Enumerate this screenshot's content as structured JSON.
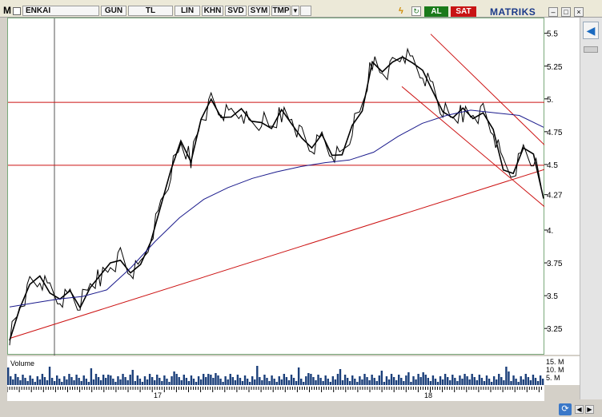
{
  "toolbar": {
    "m_label": "M",
    "symbol": "ENKAI",
    "buttons": [
      "GUN",
      "TL",
      "LIN",
      "KHN",
      "SVD",
      "SYM",
      "TMP"
    ],
    "buy_label": "AL",
    "sell_label": "SAT",
    "logo": "MATRIKS"
  },
  "colors": {
    "price": "#000000",
    "ma": "#1a1a8c",
    "trend": "#cc1111",
    "volume": "#1b3f7a",
    "grid": "#7aa87a"
  },
  "chart_data": {
    "type": "line",
    "symbol": "ENKAI",
    "ylim": [
      3.05,
      5.62
    ],
    "y_ticks": [
      "5.5",
      "5.25",
      "5.",
      "4.75",
      "4.5",
      "4.27",
      "4.",
      "3.75",
      "3.5",
      "3.25"
    ],
    "x_labels": [
      "17",
      "18"
    ],
    "last_price": "4.27",
    "price_series": [
      3.2,
      3.42,
      3.58,
      3.62,
      3.55,
      3.48,
      3.52,
      3.45,
      3.58,
      3.65,
      3.72,
      3.8,
      3.68,
      3.72,
      3.95,
      4.2,
      4.45,
      4.65,
      4.55,
      4.85,
      4.98,
      4.9,
      4.88,
      4.92,
      4.8,
      4.85,
      4.78,
      4.9,
      4.85,
      4.72,
      4.62,
      4.7,
      4.6,
      4.58,
      4.78,
      4.95,
      5.3,
      5.2,
      5.25,
      5.35,
      5.28,
      5.2,
      5.1,
      4.92,
      4.85,
      4.9,
      4.88,
      4.9,
      4.75,
      4.5,
      4.45,
      4.62,
      4.55,
      4.27
    ],
    "ma_series": [
      3.42,
      3.45,
      3.48,
      3.5,
      3.55,
      3.72,
      3.92,
      4.1,
      4.24,
      4.33,
      4.4,
      4.45,
      4.49,
      4.52,
      4.54,
      4.6,
      4.72,
      4.82,
      4.88,
      4.92,
      4.9,
      4.88,
      4.79
    ],
    "horizontal_lines": [
      4.5,
      4.98
    ],
    "volume": {
      "ticks": [
        "15. M",
        "10. M",
        "5. M"
      ]
    }
  },
  "volume_label": "Volume"
}
